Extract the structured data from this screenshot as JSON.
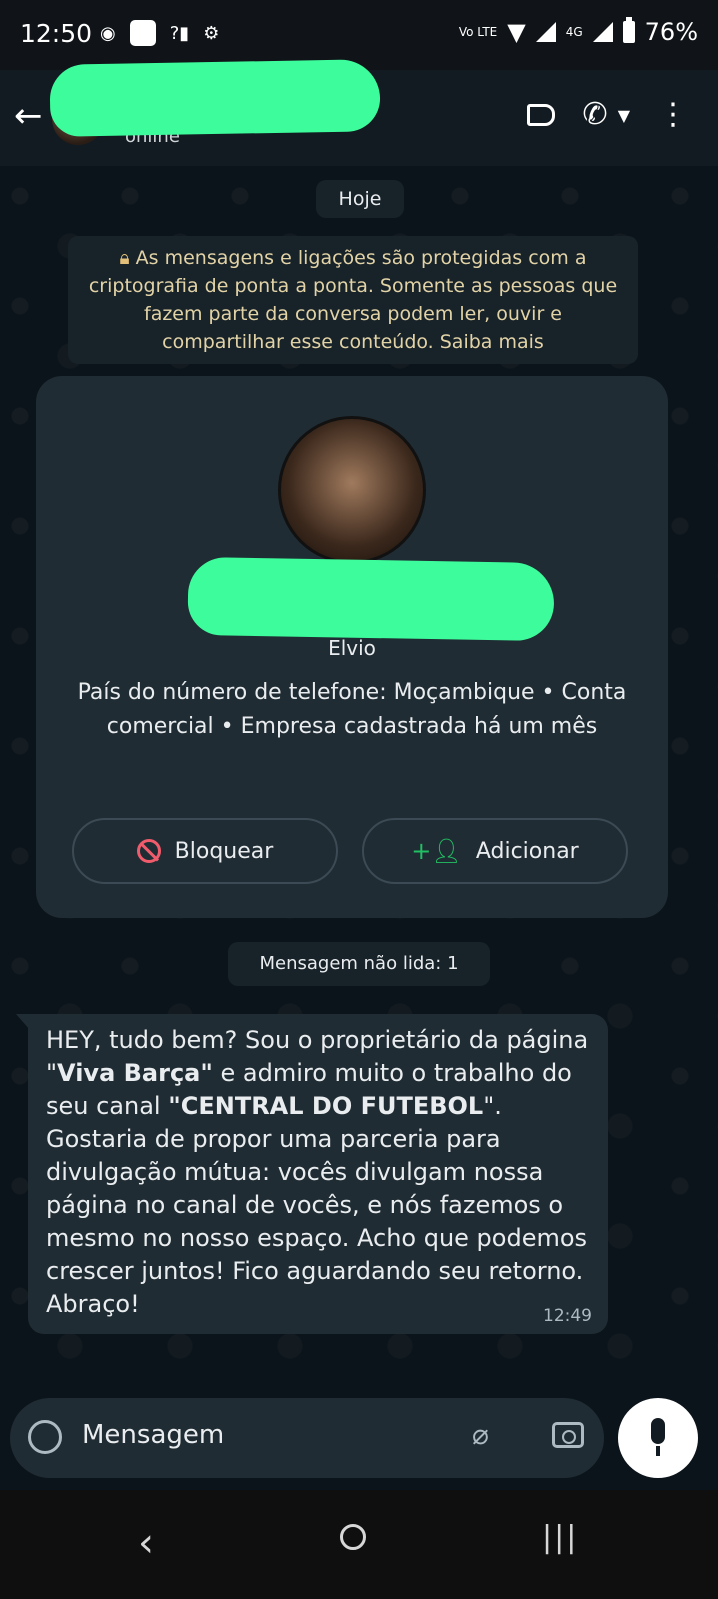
{
  "status_bar": {
    "time": "12:50",
    "left_icons": [
      "app-icon",
      "notification-square-icon",
      "no-signal-icon",
      "settings-icon"
    ],
    "volte": "Vo LTE",
    "network": "4G",
    "battery": "76%"
  },
  "header": {
    "status": "online",
    "back_icon": "arrow-left-icon",
    "icons": [
      "label-icon",
      "phone-icon",
      "caret-down-icon",
      "more-vert-icon"
    ]
  },
  "chat": {
    "date_label": "Hoje",
    "security_notice": "As mensagens e ligações são protegidas com a criptografia de ponta a ponta. Somente as pessoas que fazem parte da conversa podem ler, ouvir e compartilhar esse conteúdo. Saiba mais",
    "contact_card": {
      "name": "Elvio",
      "info": "País do número de telefone: Moçambique • Conta comercial • Empresa cadastrada há um mês",
      "block_label": "Bloquear",
      "add_label": "Adicionar"
    },
    "unread_label": "Mensagem não lida: 1",
    "message": {
      "part1": "HEY, tudo bem? Sou o proprietário da página \"",
      "bold1": "Viva Barça\"",
      "part2": " e admiro muito o trabalho do seu canal ",
      "bold2": "\"CENTRAL DO FUTEBOL",
      "part3": "\". Gostaria de propor uma parceria para divulgação mútua: vocês divulgam nossa página no canal de vocês, e nós fazemos o mesmo no nosso espaço. Acho que podemos crescer juntos! Fico aguardando seu retorno. Abraço!",
      "time": "12:49"
    }
  },
  "composer": {
    "placeholder": "Mensagem"
  },
  "colors": {
    "redaction": "#3dfc9b",
    "background": "#0b141a",
    "bubble": "#202c33",
    "add_accent": "#21c063",
    "block_accent": "#f15c6d"
  }
}
